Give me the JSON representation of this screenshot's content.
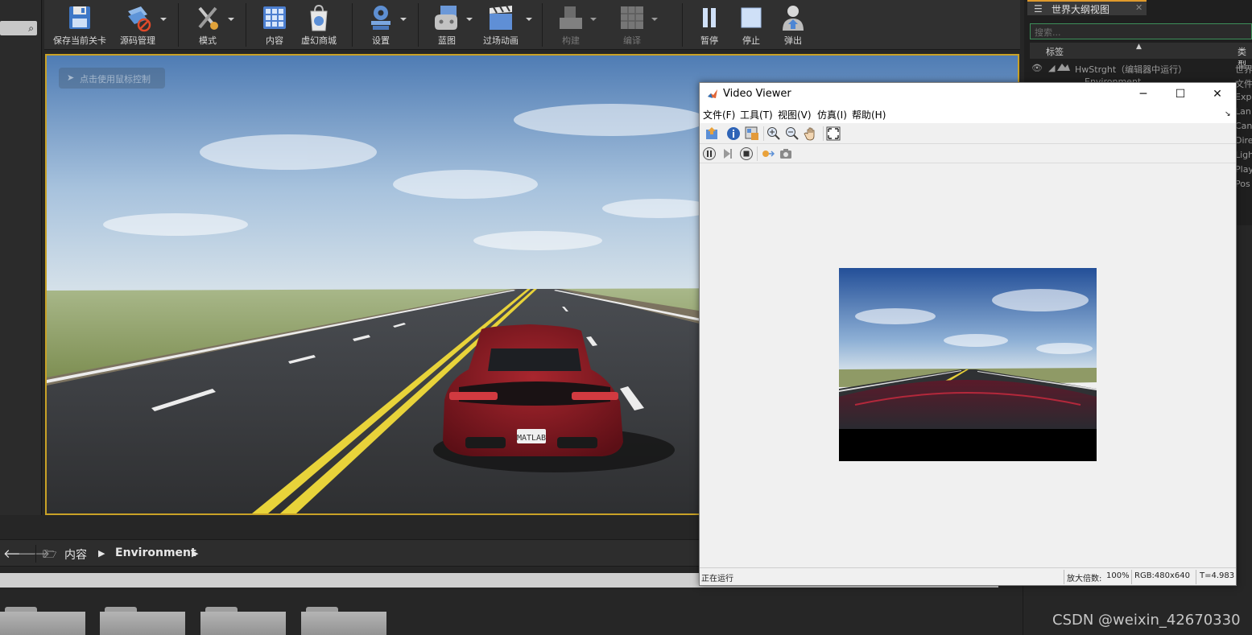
{
  "toolbar": {
    "items": [
      {
        "label": "保存当前关卡",
        "icon": "save-icon",
        "dropdown": false,
        "enabled": true
      },
      {
        "label": "源码管理",
        "icon": "source-control-icon",
        "dropdown": true,
        "enabled": true
      },
      {
        "label": "模式",
        "icon": "modes-icon",
        "dropdown": true,
        "enabled": true
      },
      {
        "label": "内容",
        "icon": "content-icon",
        "dropdown": false,
        "enabled": true
      },
      {
        "label": "虚幻商城",
        "icon": "marketplace-icon",
        "dropdown": false,
        "enabled": true
      },
      {
        "label": "设置",
        "icon": "settings-icon",
        "dropdown": true,
        "enabled": true
      },
      {
        "label": "蓝图",
        "icon": "blueprint-icon",
        "dropdown": true,
        "enabled": true
      },
      {
        "label": "过场动画",
        "icon": "cinematics-icon",
        "dropdown": true,
        "enabled": true
      },
      {
        "label": "构建",
        "icon": "build-icon",
        "dropdown": true,
        "enabled": false
      },
      {
        "label": "编译",
        "icon": "compile-icon",
        "dropdown": true,
        "enabled": false
      },
      {
        "label": "暂停",
        "icon": "pause-icon",
        "dropdown": false,
        "enabled": true
      },
      {
        "label": "停止",
        "icon": "stop-icon",
        "dropdown": false,
        "enabled": true
      },
      {
        "label": "弹出",
        "icon": "eject-icon",
        "dropdown": false,
        "enabled": true
      }
    ]
  },
  "viewport": {
    "hint": "点击使用鼠标控制",
    "plate": "MATLAB"
  },
  "content_browser": {
    "root": "内容",
    "folder": "Environment"
  },
  "outliner": {
    "tab": "世界大纲视图",
    "search_placeholder": "搜索...",
    "col_label": "标签",
    "col_type": "类型",
    "rows": [
      {
        "label": "HwStrght（编辑器中运行）",
        "type": "世界"
      },
      {
        "label": "Environment",
        "type": "文件"
      }
    ],
    "type_column_cutoff": [
      "Exp",
      "Lan",
      "Can",
      "Dire",
      "Ligh",
      "Play",
      "Pos"
    ]
  },
  "video_viewer": {
    "title": "Video Viewer",
    "menu": [
      "文件(F)",
      "工具(T)",
      "视图(V)",
      "仿真(I)",
      "帮助(H)"
    ],
    "status": {
      "left": "正在运行",
      "zoom_label": "放大倍数:",
      "zoom_value": "100%",
      "rgb": "RGB:480x640",
      "time": "T=4.983"
    }
  },
  "watermark": "CSDN @weixin_42670330",
  "colors": {
    "viewport_border": "#c9a227",
    "outliner_accent": "#e09a2c",
    "search_border": "#3d8f5a"
  }
}
